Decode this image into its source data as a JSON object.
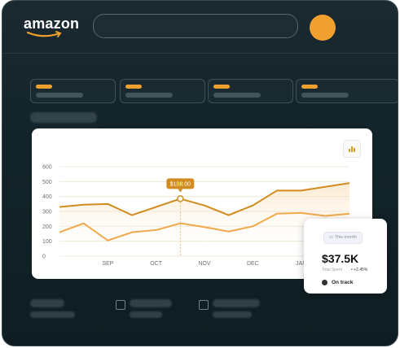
{
  "header": {
    "logo_text": "amazon",
    "brand_color": "#f0a02e",
    "search_placeholder": ""
  },
  "chart_data": {
    "type": "line",
    "x": [
      "",
      "",
      "SEP",
      "",
      "OCT",
      "",
      "NOV",
      "",
      "DEC",
      "",
      "JAN",
      "",
      ""
    ],
    "tick_labels": [
      "SEP",
      "OCT",
      "NOV",
      "DEC",
      "JAN"
    ],
    "ylim": [
      0,
      600
    ],
    "yticks": [
      0,
      100,
      200,
      300,
      400,
      500,
      600
    ],
    "series": [
      {
        "color": "#d18b1e",
        "values": [
          330,
          345,
          350,
          275,
          330,
          385,
          340,
          275,
          340,
          440,
          440,
          465,
          490
        ]
      },
      {
        "color": "#f0a94a",
        "values": [
          160,
          220,
          105,
          160,
          175,
          220,
          195,
          165,
          200,
          285,
          290,
          270,
          285
        ]
      }
    ],
    "annotation": {
      "label": "$108.00",
      "series": 0,
      "index": 5
    },
    "grid": true
  },
  "tooltip_card": {
    "chip": "This month",
    "value": "$37.5K",
    "sub_label": "Total Spent",
    "delta": "+2.45%",
    "status": "On track"
  }
}
